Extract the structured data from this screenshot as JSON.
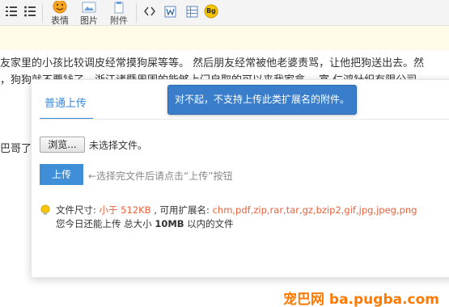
{
  "toolbar": {
    "emoji_label": "表情",
    "image_label": "图片",
    "attachment_label": "附件",
    "bg_badge": "Bg"
  },
  "article": {
    "line1": "友家里的小孩比较调皮经常摸狗屎等等。 然后朋友经常被他老婆责骂，让他把狗送出去。然",
    "line2": "，狗狗就不要钱了，浙江诸暨周围的能够上门自取的可以来我家拿。 富 仁鸿针织有限公司 ",
    "line3": "巴哥了"
  },
  "dialog": {
    "tab_label": "普通上传",
    "browse_label": "浏览...",
    "no_file_text": "未选择文件。",
    "upload_label": "上传",
    "upload_hint": "←选择完文件后请点击“上传”按钮",
    "size_prefix": "文件尺寸: ",
    "size_limit": "小于 512KB",
    "ext_prefix": " , 可用扩展名: ",
    "extensions": "chm,pdf,zip,rar,tar,gz,bzip2,gif,jpg,jpeg,png",
    "quota_prefix": "您今日还能上传 总大小 ",
    "quota_value": "10MB",
    "quota_suffix": " 以内的文件"
  },
  "toast": {
    "message": "对不起，不支持上传此类扩展名的附件。"
  },
  "watermark": {
    "text": "宠巴网  ba.pugba.com"
  },
  "colors": {
    "accent": "#3b8ad8",
    "toast_bg": "#3a7ecb",
    "warning_text": "#e8613b",
    "watermark": "#ff7a00"
  }
}
